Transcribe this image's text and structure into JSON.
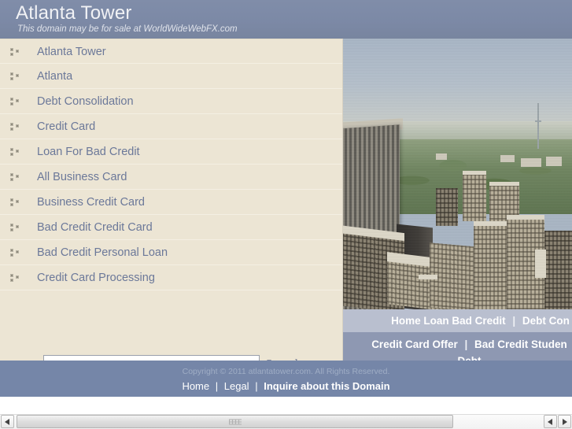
{
  "header": {
    "title": "Atlanta Tower",
    "tagline": "This domain may be for sale at WorldWideWebFX.com"
  },
  "links": [
    {
      "label": "Atlanta Tower"
    },
    {
      "label": "Atlanta"
    },
    {
      "label": "Debt Consolidation"
    },
    {
      "label": "Credit Card"
    },
    {
      "label": "Loan For Bad Credit"
    },
    {
      "label": "All Business Card"
    },
    {
      "label": "Business Credit Card"
    },
    {
      "label": "Bad Credit Credit Card"
    },
    {
      "label": "Bad Credit Personal Loan"
    },
    {
      "label": "Credit Card Processing"
    }
  ],
  "search": {
    "value": "",
    "placeholder": "",
    "button_label": "Search"
  },
  "overlay": {
    "row1": {
      "link1": "Home Loan Bad Credit",
      "separator": "|",
      "link2": "Debt Con"
    },
    "row2": {
      "link1": "Credit Card Offer",
      "separator": "|",
      "link2": "Bad Credit Studen",
      "link2_wrap": "Debt"
    }
  },
  "footer": {
    "copyright": "Copyright © 2011 atlantatower.com. All Rights Reserved.",
    "nav": {
      "home": "Home",
      "sep1": "|",
      "legal": "Legal",
      "sep2": "|",
      "inquire": "Inquire about this Domain"
    }
  },
  "photo": {
    "alt_name": "atlanta-skyline-aerial-photo"
  },
  "scrollbar": {
    "left_arrow": "◀",
    "right_arrow": "▶"
  },
  "colors": {
    "header_blue": "#7c89a6",
    "panel_beige": "#ece5d4",
    "link_blue": "#6b7899",
    "footer_blue": "#7586a8",
    "overlay_light": "#b9bfcf",
    "overlay_dark": "#8e98b2"
  }
}
